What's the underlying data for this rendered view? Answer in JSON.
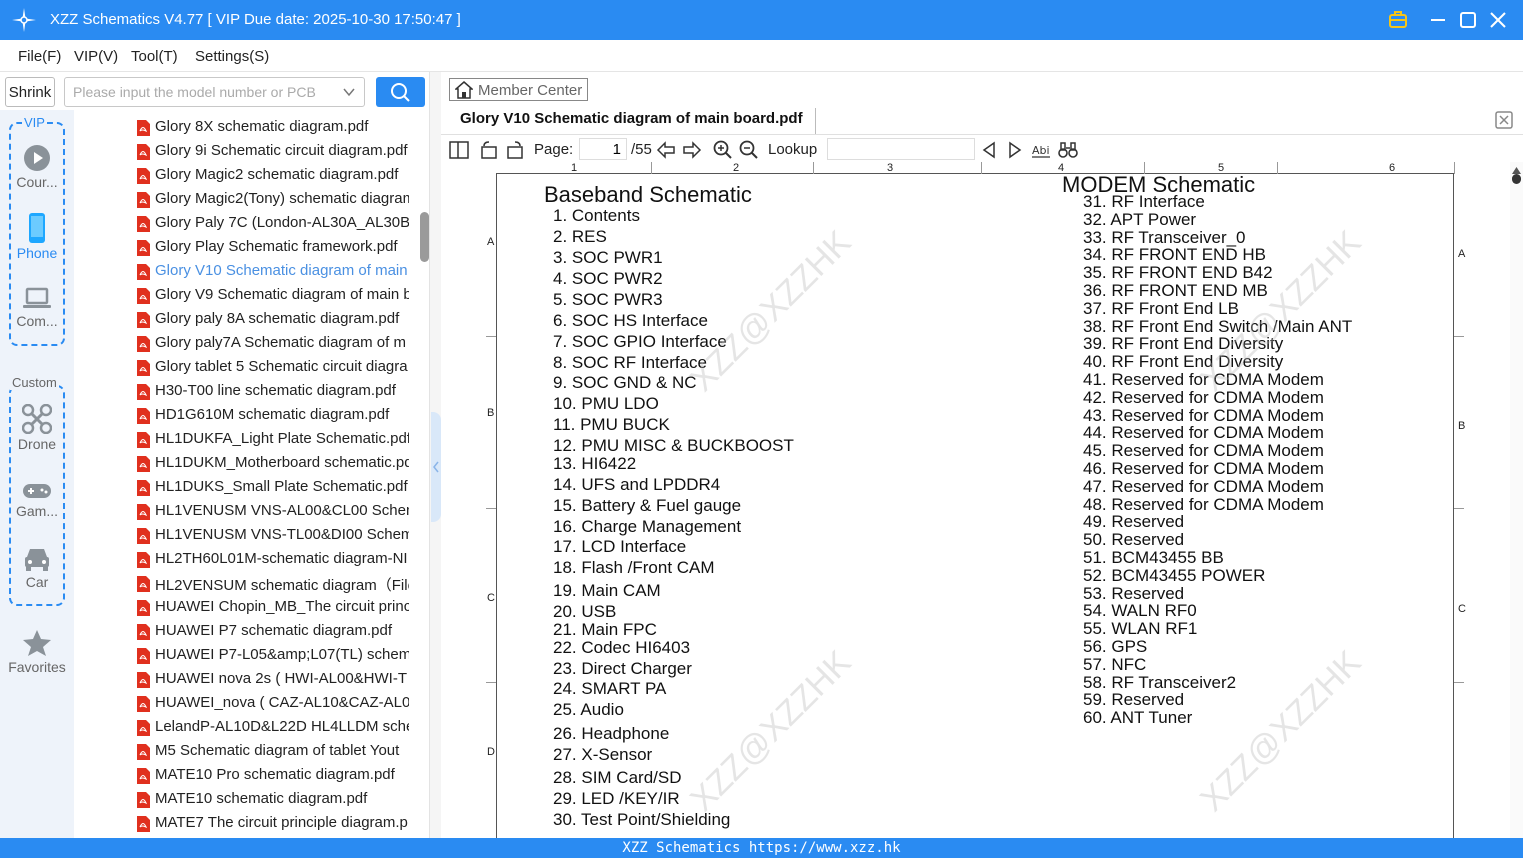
{
  "app": {
    "title": "XZZ Schematics V4.77 [ VIP Due date: 2025-10-30 17:50:47 ]"
  },
  "menu": [
    "File(F)",
    "VIP(V)",
    "Tool(T)",
    "Settings(S)"
  ],
  "search": {
    "shrink_label": "Shrink",
    "placeholder": "Please input the model number or PCB"
  },
  "rail": {
    "vip_title": "VIP",
    "custom_title": "Custom",
    "items": [
      {
        "label": "Cour...",
        "icon": "play-circle-icon"
      },
      {
        "label": "Phone",
        "icon": "phone-icon",
        "active": true
      },
      {
        "label": "Com...",
        "icon": "laptop-icon"
      },
      {
        "label": "Drone",
        "icon": "drone-icon"
      },
      {
        "label": "Gam...",
        "icon": "gamepad-icon"
      },
      {
        "label": "Car",
        "icon": "car-icon"
      }
    ],
    "favorites_label": "Favorites"
  },
  "files": [
    "Glory 8X schematic diagram.pdf",
    "Glory 9i Schematic circuit diagram.pdf",
    "Glory Magic2 schematic diagram.pdf",
    "Glory Magic2(Tony) schematic diagram",
    "Glory Paly 7C (London-AL30A_AL30B_",
    "Glory Play Schematic framework.pdf",
    "Glory V10 Schematic diagram of main",
    "Glory V9 Schematic diagram of main b",
    "Glory paly 8A schematic diagram.pdf",
    "Glory paly7A Schematic diagram of m",
    "Glory tablet 5 Schematic circuit diagra",
    "H30-T00 line schematic diagram.pdf",
    "HD1G610M schematic diagram.pdf",
    "HL1DUKFA_Light Plate Schematic.pdf",
    "HL1DUKM_Motherboard schematic.pdf",
    "HL1DUKS_Small Plate Schematic.pdf",
    "HL1VENUSM VNS-AL00&CL00 Schem",
    "HL1VENUSM VNS-TL00&DI00 Schema",
    "HL2TH60L01M-schematic diagram-NI",
    "HL2VENSUM schematic diagram（File",
    "HUAWEI Chopin_MB_The circuit princ",
    "HUAWEI P7 schematic diagram.pdf",
    "HUAWEI P7-L05&amp;L07(TL) schema",
    "HUAWEI nova 2s ( HWI-AL00&HWI-T",
    "HUAWEI_nova ( CAZ-AL10&CAZ-AL0",
    "LelandP-AL10D&L22D HL4LLDM sche",
    "M5 Schematic diagram of tablet Yout",
    "MATE10 Pro schematic diagram.pdf",
    "MATE10 schematic diagram.pdf",
    "MATE7 The circuit principle diagram.p"
  ],
  "active_file_index": 6,
  "viewer": {
    "member_center": "Member Center",
    "tab_title": "Glory V10 Schematic diagram of main board.pdf",
    "page_label": "Page:",
    "page_current": "1",
    "page_total": "/55",
    "lookup_label": "Lookup",
    "ruler_cols": [
      "1",
      "2",
      "3",
      "4",
      "5",
      "6"
    ],
    "ruler_rows": [
      "A",
      "B",
      "C",
      "D"
    ]
  },
  "schematic": {
    "left_title": "Baseband Schematic",
    "right_title": "MODEM Schematic",
    "left_items": [
      "1.  Contents",
      "2.  RES",
      "3.  SOC PWR1",
      "4.  SOC PWR2",
      "5.  SOC PWR3",
      "6.  SOC HS Interface",
      "7.  SOC GPIO Interface",
      "8.  SOC RF Interface",
      "9.  SOC GND & NC",
      "10. PMU LDO",
      "11. PMU BUCK",
      "12. PMU MISC & BUCKBOOST",
      "13. HI6422",
      "14. UFS and LPDDR4",
      "15. Battery & Fuel gauge",
      "16. Charge Management",
      "17. LCD Interface",
      "18. Flash /Front CAM",
      "19. Main CAM",
      "20. USB",
      "21. Main FPC",
      "22. Codec HI6403",
      "23. Direct Charger",
      "24. SMART PA",
      "25. Audio",
      "26. Headphone",
      "27. X-Sensor",
      "28. SIM Card/SD",
      "29. LED /KEY/IR",
      "30. Test Point/Shielding"
    ],
    "right_items": [
      "31. RF Interface",
      "32. APT Power",
      "33. RF Transceiver_0",
      "34. RF FRONT END HB",
      "35. RF FRONT END B42",
      "36. RF FRONT END MB",
      "37. RF Front End LB",
      "38. RF Front End Switch /Main ANT",
      "39. RF Front End Diversity",
      "40. RF Front End Diversity",
      "41. Reserved for CDMA Modem",
      "42. Reserved for CDMA Modem",
      "43. Reserved for CDMA Modem",
      "44. Reserved for CDMA Modem",
      "45. Reserved for CDMA Modem",
      "46. Reserved for CDMA Modem",
      "47. Reserved for CDMA Modem",
      "48. Reserved for CDMA Modem",
      "49. Reserved",
      "50. Reserved",
      "51. BCM43455 BB",
      "52. BCM43455 POWER",
      "53. Reserved",
      "54. WALN RF0",
      "55. WLAN RF1",
      "56. GPS",
      "57. NFC",
      "58. RF Transceiver2",
      "59. Reserved",
      "60. ANT Tuner"
    ],
    "watermark": "XZZ@XZZHK"
  },
  "status": {
    "text": "XZZ Schematics https://www.xzz.hk"
  },
  "colors": {
    "accent": "#2a8bf2",
    "active_file": "#4a90e2",
    "pdf_icon": "#e0301e"
  }
}
